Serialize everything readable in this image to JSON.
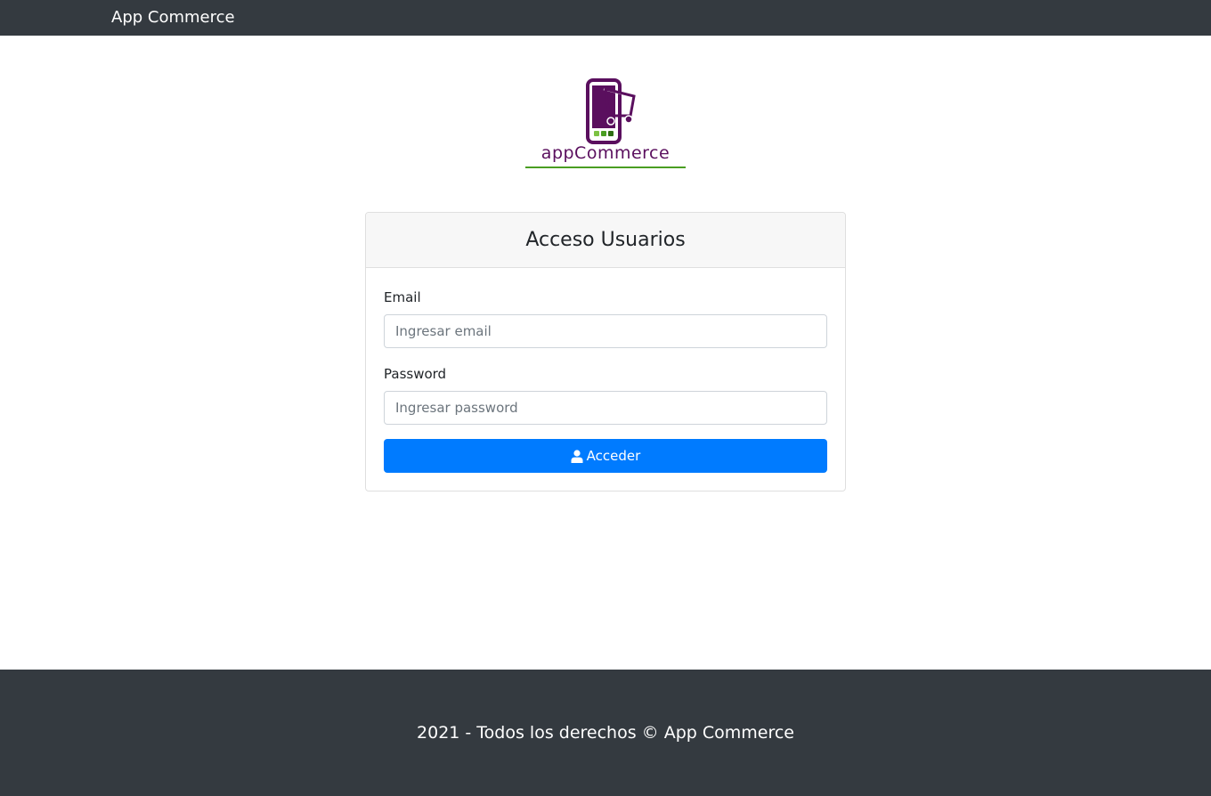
{
  "navbar": {
    "brand": "App Commerce"
  },
  "logo": {
    "text": "appCommerce",
    "icon": "phone-cart-icon",
    "colors": {
      "purple": "#5a0f5e",
      "green": "#4a9e22"
    }
  },
  "login": {
    "title": "Acceso Usuarios",
    "email_label": "Email",
    "email_placeholder": "Ingresar email",
    "email_value": "",
    "password_label": "Password",
    "password_placeholder": "Ingresar password",
    "password_value": "",
    "submit_label": "Acceder",
    "submit_icon": "user-icon"
  },
  "footer": {
    "text": "2021 - Todos los derechos © App Commerce"
  },
  "colors": {
    "navbar": "#343a40",
    "primary": "#007bff",
    "footer": "#343a40"
  }
}
